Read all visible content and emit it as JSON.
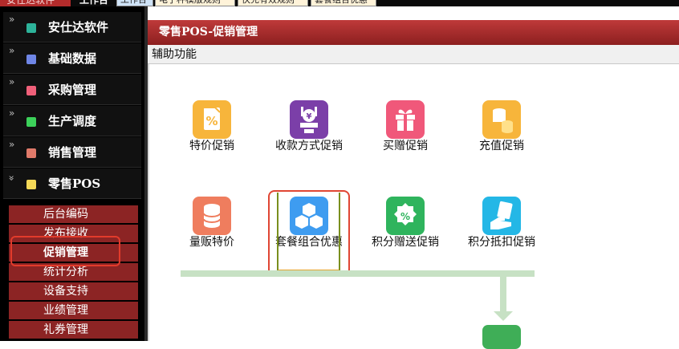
{
  "topbar": {
    "brand": "安仕达软件",
    "workspace": "工作台",
    "tabs": [
      "工作台",
      "电子秤模版规则",
      "快充有效规则",
      "套餐组合优惠"
    ]
  },
  "sidebar": {
    "groups": [
      {
        "label": "安仕达软件",
        "chevron": "»",
        "color": "#2db39a"
      },
      {
        "label": "基础数据",
        "chevron": "»",
        "color": "#6f86e6"
      },
      {
        "label": "采购管理",
        "chevron": "»",
        "color": "#f0607a"
      },
      {
        "label": "生产调度",
        "chevron": "»",
        "color": "#3cd15a"
      },
      {
        "label": "销售管理",
        "chevron": "»",
        "color": "#e07a6a"
      },
      {
        "label": "零售POS",
        "chevron": "»",
        "color": "#f4d857"
      }
    ],
    "submenu": [
      "后台编码",
      "发布接收",
      "促销管理",
      "统计分析",
      "设备支持",
      "业绩管理",
      "礼券管理"
    ],
    "active_submenu": "促销管理"
  },
  "main": {
    "title": "零售POS-促销管理",
    "subtitle": "辅助功能",
    "functions": [
      {
        "label": "特价促销",
        "icon": "percent-tag-icon",
        "color": "#f7b53b"
      },
      {
        "label": "收款方式促销",
        "icon": "money-hand-icon",
        "color": "#7b3fa8"
      },
      {
        "label": "买赠促销",
        "icon": "gift-icon",
        "color": "#f0587a"
      },
      {
        "label": "充值促销",
        "icon": "coin-stack-icon",
        "color": "#f7b53b"
      },
      {
        "label": "量贩特价",
        "icon": "database-icon",
        "color": "#ef7d5e"
      },
      {
        "label": "套餐组合优惠",
        "icon": "cubes-icon",
        "color": "#3e9cf0"
      },
      {
        "label": "积分赠送促销",
        "icon": "discount-badge-icon",
        "color": "#2fb45d"
      },
      {
        "label": "积分抵扣促销",
        "icon": "voucher-hand-icon",
        "color": "#24b7e6"
      }
    ],
    "flow_color": "#c7e1c4"
  }
}
